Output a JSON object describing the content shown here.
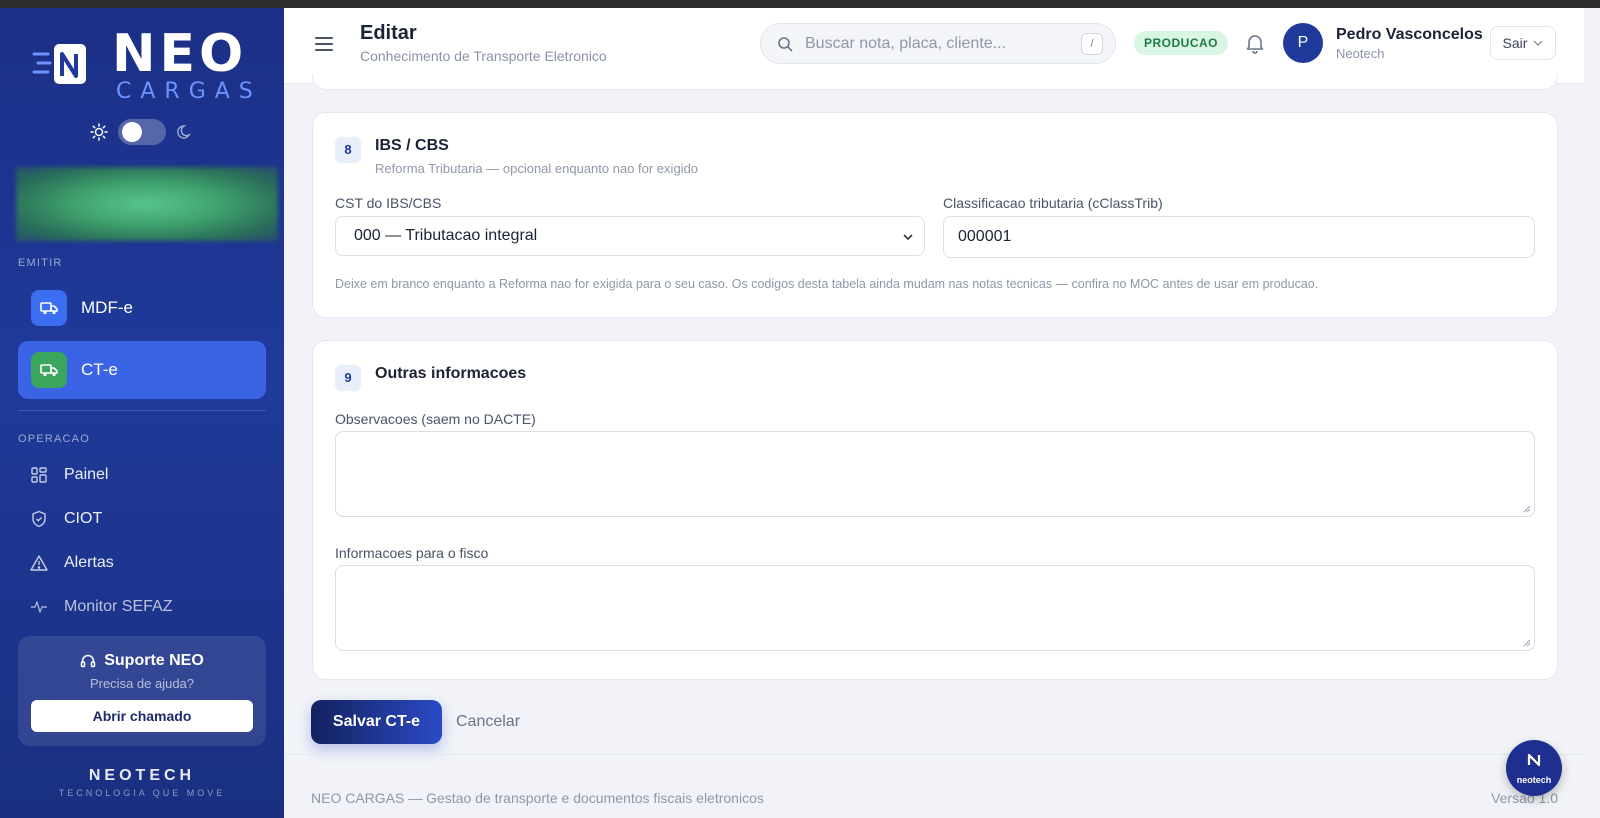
{
  "sidebar": {
    "logo": {
      "neo": "NEO",
      "cargas": "CARGAS"
    },
    "sections": {
      "emitir": "EMITIR",
      "operacao": "OPERACAO"
    },
    "emit_items": [
      {
        "label": "MDF-e",
        "icon": "truck-icon"
      },
      {
        "label": "CT-e",
        "icon": "truck-icon",
        "active": true
      }
    ],
    "op_items": [
      {
        "label": "Painel",
        "icon": "grid-icon"
      },
      {
        "label": "CIOT",
        "icon": "shield-icon"
      },
      {
        "label": "Alertas",
        "icon": "warning-icon"
      },
      {
        "label": "Monitor SEFAZ",
        "icon": "activity-icon"
      }
    ],
    "support": {
      "title": "Suporte NEO",
      "subtitle": "Precisa de ajuda?",
      "button": "Abrir chamado"
    },
    "brand": {
      "name": "NEOTECH",
      "tagline": "TECNOLOGIA QUE MOVE"
    }
  },
  "header": {
    "title": "Editar",
    "subtitle": "Conhecimento de Transporte Eletronico",
    "search_placeholder": "Buscar nota, placa, cliente...",
    "search_shortcut": "/",
    "environment": "PRODUCAO",
    "user": {
      "initial": "P",
      "name": "Pedro Vasconcelos",
      "org": "Neotech"
    },
    "logout": "Sair"
  },
  "sections": {
    "ibs": {
      "number": "8",
      "title": "IBS / CBS",
      "subtitle": "Reforma Tributaria — opcional enquanto nao for exigido",
      "cst_label": "CST do IBS/CBS",
      "cst_value": "000 — Tributacao integral",
      "class_label": "Classificacao tributaria (cClassTrib)",
      "class_value": "000001",
      "hint": "Deixe em branco enquanto a Reforma nao for exigida para o seu caso. Os codigos desta tabela ainda mudam nas notas tecnicas — confira no MOC antes de usar em producao."
    },
    "outras": {
      "number": "9",
      "title": "Outras informacoes",
      "obs_label": "Observacoes (saem no DACTE)",
      "obs_value": "",
      "fisco_label": "Informacoes para o fisco",
      "fisco_value": ""
    }
  },
  "actions": {
    "save": "Salvar CT-e",
    "cancel": "Cancelar"
  },
  "footer": {
    "text": "NEO CARGAS — Gestao de transporte e documentos fiscais eletronicos",
    "version": "Versao 1.0"
  },
  "fab": {
    "label": "neotech"
  },
  "colors": {
    "sidebar": "#1f3a9a",
    "accent": "#3b63e6",
    "badge_bg": "#d9f5e4",
    "badge_text": "#1e7a44"
  }
}
